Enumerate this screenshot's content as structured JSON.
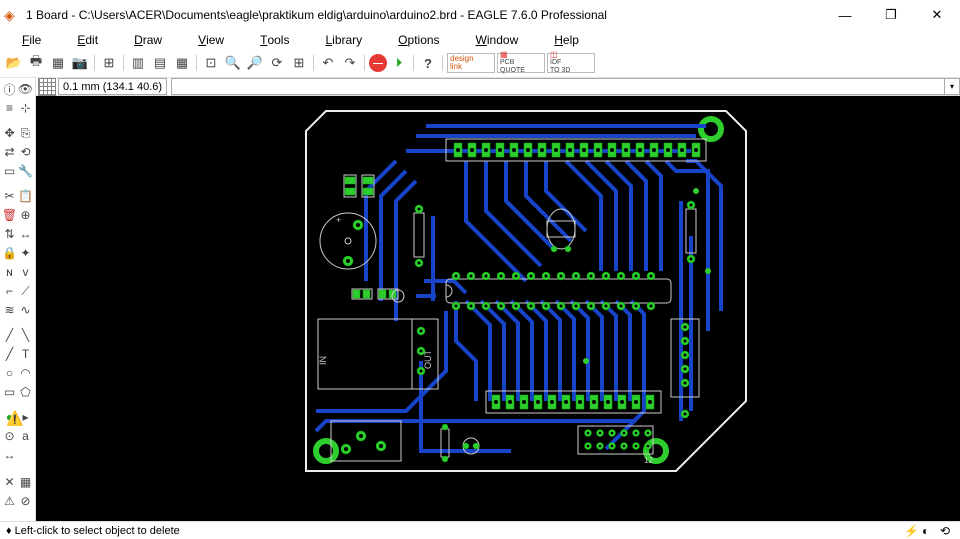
{
  "window": {
    "title": "1 Board - C:\\Users\\ACER\\Documents\\eagle\\praktikum eldig\\arduino\\arduino2.brd - EAGLE 7.6.0 Professional",
    "minimize": "—",
    "maximize": "❐",
    "close": "✕"
  },
  "menu": {
    "file": "File",
    "edit": "Edit",
    "draw": "Draw",
    "view": "View",
    "tools": "Tools",
    "library": "Library",
    "options": "Options",
    "window": "Window",
    "help": "Help"
  },
  "toolbar_ext": {
    "designlink": "design\nlink",
    "pcbquote": "PCB\nQUOTE",
    "idf3d": "IDF\nTO 3D"
  },
  "coords": "0.1 mm (134.1 40.6)",
  "status": {
    "text": "♦  Left-click to select object to delete",
    "bolt": "⚡",
    "i1": "◐",
    "i2": "⟲"
  },
  "pcb_labels": {
    "in": "IN",
    "out": "OUT",
    "u12": "12"
  },
  "cmd_value": ""
}
